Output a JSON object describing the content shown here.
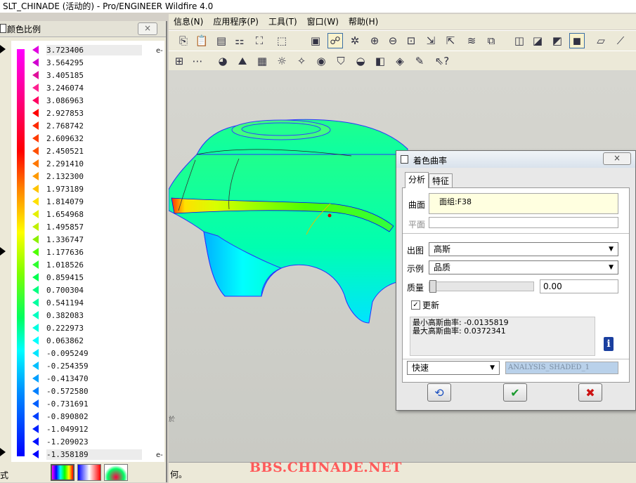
{
  "window": {
    "title": "SLT_CHINADE (活动的) - Pro/ENGINEER Wildfire 4.0"
  },
  "menubar": {
    "items": [
      "信息(N)",
      "应用程序(P)",
      "工具(T)",
      "窗口(W)",
      "帮助(H)"
    ]
  },
  "scale_panel": {
    "title": "颜色比例",
    "close": "×",
    "exponent_label": "e-",
    "values": [
      "3.723406",
      "3.564295",
      "3.405185",
      "3.246074",
      "3.086963",
      "2.927853",
      "2.768742",
      "2.609632",
      "2.450521",
      "2.291410",
      "2.132300",
      "1.973189",
      "1.814079",
      "1.654968",
      "1.495857",
      "1.336747",
      "1.177636",
      "1.018526",
      "0.859415",
      "0.700304",
      "0.541194",
      "0.382083",
      "0.222973",
      "0.063862",
      "-0.095249",
      "-0.254359",
      "-0.413470",
      "-0.572580",
      "-0.731691",
      "-0.890802",
      "-1.049912",
      "-1.209023",
      "-1.358189"
    ],
    "tick_colors": [
      "#e000e0",
      "#d000d0",
      "#e0109c",
      "#ff2090",
      "#ff0060",
      "#ff0000",
      "#ff2a00",
      "#ff3c00",
      "#ff5000",
      "#ff7800",
      "#ff9a00",
      "#ffc400",
      "#ffe000",
      "#e6f000",
      "#bff000",
      "#8cf000",
      "#50ff00",
      "#30ff30",
      "#00ff50",
      "#00ff80",
      "#00ffa0",
      "#00ffc0",
      "#00ffe0",
      "#00ffff",
      "#00e6ff",
      "#00c0ff",
      "#00a0ff",
      "#0080ff",
      "#0060ff",
      "#0040ff",
      "#0020ff",
      "#0010ff",
      "#0000ff"
    ],
    "bottom_label": "式"
  },
  "dialog": {
    "title": "着色曲率",
    "tabs": [
      "分析",
      "特征"
    ],
    "surface_label": "曲面",
    "surface_value": "面组:F38",
    "plane_label": "平面",
    "output_label": "出图",
    "output_value": "高斯",
    "display_label": "示例",
    "display_value": "品质",
    "quality_label": "质量",
    "quality_value": "0.00",
    "quality_level": 0,
    "update_label": "更新",
    "update_checked": true,
    "result_min": "最小高斯曲率: -0.0135819",
    "result_max": "最大高斯曲率: 0.0372341",
    "mode_value": "快速",
    "analysis_name": "ANALYSIS_SHADED_1",
    "close": "×"
  },
  "status": {
    "message": "何。"
  },
  "viewport": {
    "small_text": "於"
  },
  "watermark": "BBS.CHINADE.NET"
}
